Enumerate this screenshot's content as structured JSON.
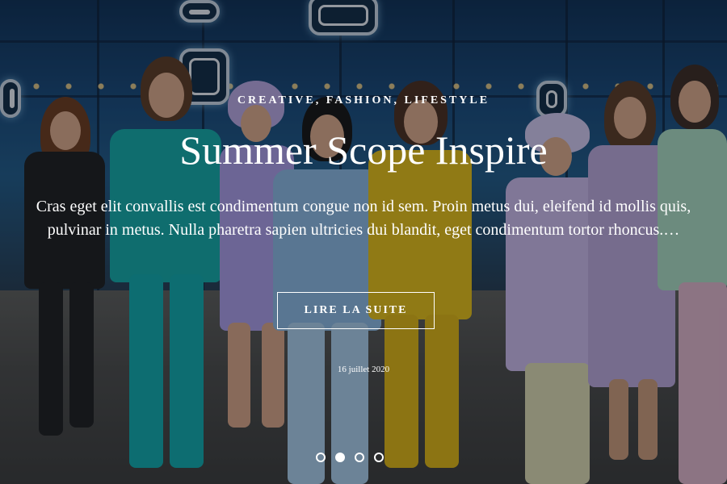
{
  "slider": {
    "category": "CREATIVE, FASHION, LIFESTYLE",
    "title": "Summer Scope Inspire",
    "excerpt": "Cras eget elit convallis est condimentum congue non id sem. Proin metus dui, eleifend id mollis quis, pulvinar in metus. Nulla pharetra sapien ultricies dui blandit, eget condimentum tortor rhoncus.…",
    "read_more_label": "LIRE LA SUITE",
    "date": "16 juillet 2020",
    "active_slide": 2,
    "slide_count": 4
  },
  "colors": {
    "text": "#ffffff",
    "overlay": "rgba(10,12,18,0.38)"
  }
}
